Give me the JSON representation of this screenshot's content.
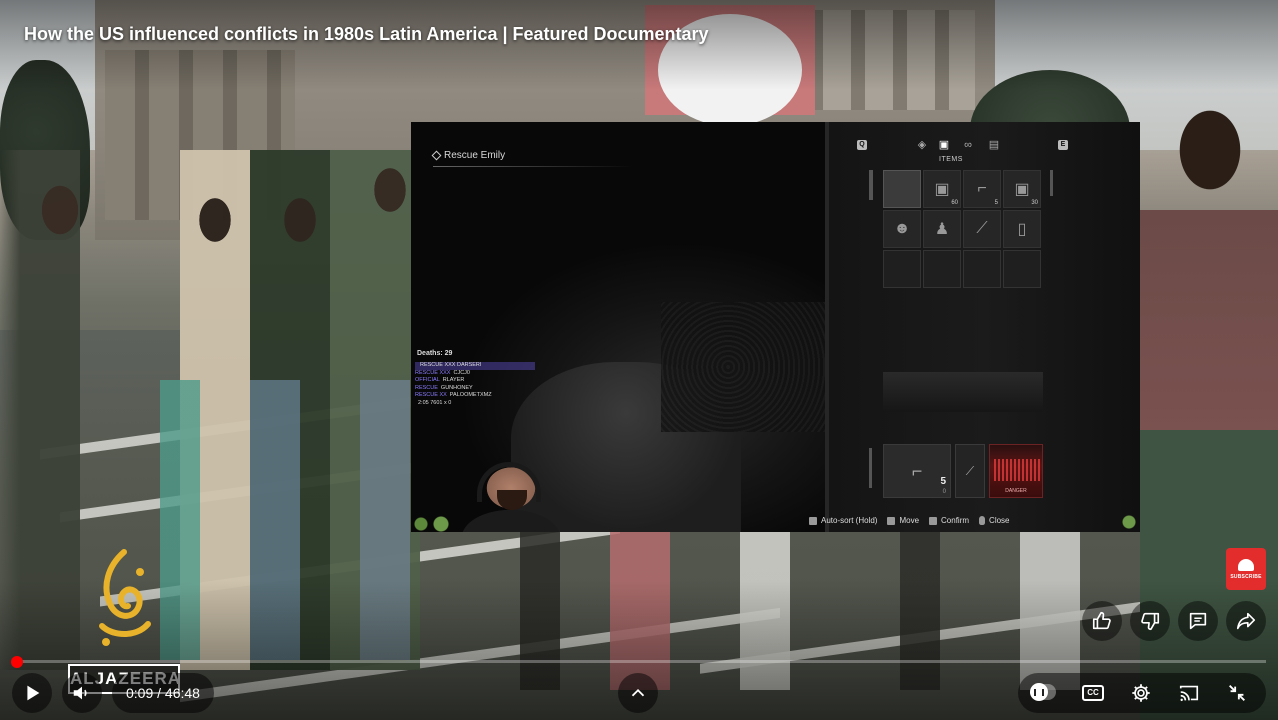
{
  "video": {
    "title": "How the US influenced conflicts in 1980s Latin America | Featured Documentary",
    "current_time": "0:09",
    "duration": "46:48",
    "time_separator": " / ",
    "progress_fraction": 0.0032
  },
  "channel": {
    "logo_text": "ALJAZEERA",
    "subscribe_label": "SUBSCRIBE"
  },
  "stream": {
    "objective": "Rescue Emily",
    "deaths_label": "Deaths: 29",
    "chat": [
      {
        "tag": "",
        "text": "RESCUE XXX DARSERI",
        "highlight": true
      },
      {
        "tag": "RESCUE XXX",
        "text": "CJCJ0",
        "highlight": false
      },
      {
        "tag": "OFFICIAL",
        "text": "RLAYER",
        "highlight": false
      },
      {
        "tag": "RESCUE",
        "text": "GUNHONEY",
        "highlight": false
      },
      {
        "tag": "RESCUE XX",
        "text": "PALOOMETXMZ",
        "highlight": false
      },
      {
        "tag": "",
        "text": "2:05  7601 x 0",
        "highlight": false
      }
    ],
    "inventory": {
      "tab_label": "ITEMS",
      "key_left": "Q",
      "key_right": "E",
      "cells": [
        {
          "icon": "empty-selected",
          "glyph": "",
          "qty": ""
        },
        {
          "icon": "ammo-canister-icon",
          "glyph": "▣",
          "qty": "60"
        },
        {
          "icon": "handgun-icon",
          "glyph": "⌐",
          "qty": "5"
        },
        {
          "icon": "ammo-box-icon",
          "glyph": "▣",
          "qty": "30"
        },
        {
          "icon": "mask-icon",
          "glyph": "☻",
          "qty": ""
        },
        {
          "icon": "figure-icon",
          "glyph": "♟",
          "qty": ""
        },
        {
          "icon": "syringe-icon",
          "glyph": "⟋",
          "qty": ""
        },
        {
          "icon": "bottle-icon",
          "glyph": "▯",
          "qty": ""
        },
        {
          "icon": "empty",
          "glyph": "",
          "qty": ""
        },
        {
          "icon": "empty",
          "glyph": "",
          "qty": ""
        },
        {
          "icon": "empty",
          "glyph": "",
          "qty": ""
        },
        {
          "icon": "empty",
          "glyph": "",
          "qty": ""
        }
      ],
      "equipped_ammo": "5",
      "equipped_reserve": "0",
      "health_status": "DANGER"
    },
    "controls": [
      {
        "key": "btn",
        "label": "Auto-sort (Hold)"
      },
      {
        "key": "btn",
        "label": "Move"
      },
      {
        "key": "btn",
        "label": "Confirm"
      },
      {
        "key": "mouse",
        "label": "Close"
      }
    ]
  },
  "actions": {
    "like": "like-icon",
    "dislike": "dislike-icon",
    "comments": "comments-icon",
    "share": "share-icon"
  },
  "player_controls": {
    "cc_label": "CC"
  },
  "colors": {
    "progress": "#ff0000",
    "subscribe": "#e32d2d",
    "health": "#e23a3a"
  }
}
